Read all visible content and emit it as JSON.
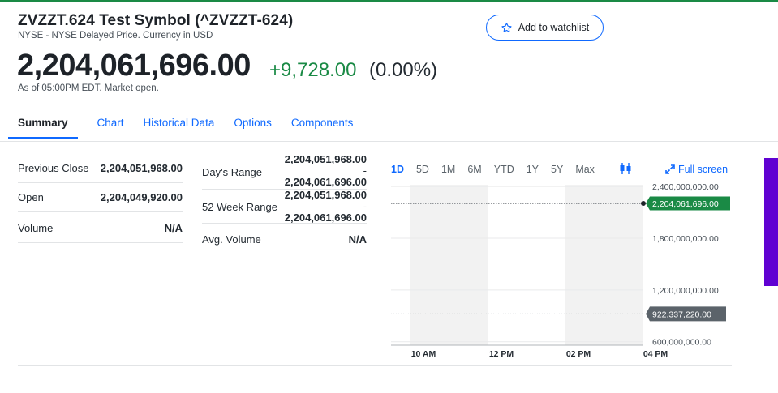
{
  "header": {
    "title": "ZVZZT.624 Test Symbol (^ZVZZT-624)",
    "subtitle": "NYSE - NYSE Delayed Price. Currency in USD",
    "price": "2,204,061,696.00",
    "change": "+9,728.00",
    "change_pct": "(0.00%)",
    "as_of": "As of 05:00PM EDT. Market open.",
    "watchlist_label": "Add to watchlist"
  },
  "tabs": [
    {
      "label": "Summary",
      "active": true
    },
    {
      "label": "Chart"
    },
    {
      "label": "Historical Data"
    },
    {
      "label": "Options"
    },
    {
      "label": "Components"
    }
  ],
  "stats_left": [
    {
      "label": "Previous Close",
      "value": "2,204,051,968.00"
    },
    {
      "label": "Open",
      "value": "2,204,049,920.00"
    },
    {
      "label": "Volume",
      "value": "N/A"
    }
  ],
  "stats_right": {
    "days_range": {
      "label": "Day's Range",
      "low": "2,204,051,968.00",
      "sep": "-",
      "high": "2,204,061,696.00"
    },
    "week52_range": {
      "label": "52 Week Range",
      "low": "2,204,051,968.00",
      "sep": "-",
      "high": "2,204,061,696.00"
    },
    "avg_volume": {
      "label": "Avg. Volume",
      "value": "N/A"
    }
  },
  "chart_controls": {
    "ranges": [
      "1D",
      "5D",
      "1M",
      "6M",
      "YTD",
      "1Y",
      "5Y",
      "Max"
    ],
    "active_range": "1D",
    "fullscreen_label": "Full screen"
  },
  "chart_data": {
    "type": "line",
    "x_ticks": [
      "10 AM",
      "12 PM",
      "02 PM",
      "04 PM"
    ],
    "y_ticks": [
      "2,400,000,000.00",
      "1,800,000,000.00",
      "1,200,000,000.00",
      "600,000,000.00"
    ],
    "y_tick_values": [
      2400000000,
      1800000000,
      1200000000,
      600000000
    ],
    "ylim": [
      560000000,
      2420000000
    ],
    "series": [
      {
        "values": [
          2204061696,
          2204061696
        ]
      }
    ],
    "current_price_label": "2,204,061,696.00",
    "current_price_value": 2204061696,
    "reference_label": "922,337,220.00",
    "reference_value": 922337220,
    "colors": {
      "price_tag": "#1a8a45",
      "reference_tag": "#5b636a",
      "shade": "#f2f2f2"
    }
  }
}
